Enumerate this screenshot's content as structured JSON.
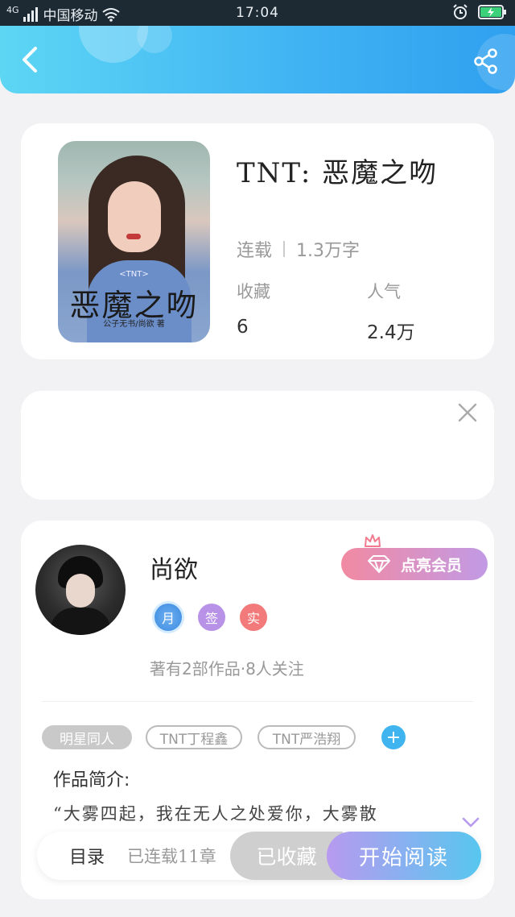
{
  "status_bar": {
    "network": "4G",
    "carrier": "中国移动",
    "time": "17:04"
  },
  "colors": {
    "header_gradient_start": "#5dd6f4",
    "header_gradient_end": "#2fa0ef",
    "accent_blue": "#3fb4ee",
    "vip_start": "#f28aa2",
    "vip_end": "#c19ae5",
    "read_start": "#b89af0",
    "read_end": "#57c7ef"
  },
  "header": {
    "back_icon": "chevron-left-icon",
    "share_icon": "share-icon"
  },
  "book": {
    "cover": {
      "tag": "<TNT>",
      "title": "恶魔之吻",
      "author_line": "公子无书/尚欲 著"
    },
    "title": "TNT: 恶魔之吻",
    "status": "连载",
    "word_count": "1.3万字",
    "stats": [
      {
        "label": "收藏",
        "value": "6"
      },
      {
        "label": "人气",
        "value": "2.4万"
      }
    ]
  },
  "author": {
    "name": "尚欲",
    "vip_button": "点亮会员",
    "badges": [
      {
        "text": "月",
        "color": "#4a9be8"
      },
      {
        "text": "签",
        "color": "#b892e6"
      },
      {
        "text": "实",
        "color": "#f27a7a"
      }
    ],
    "meta": "著有2部作品·8人关注"
  },
  "tags": [
    {
      "label": "明星同人",
      "style": "filled"
    },
    {
      "label": "TNT丁程鑫",
      "style": "outline"
    },
    {
      "label": "TNT严浩翔",
      "style": "outline"
    }
  ],
  "intro": {
    "title": "作品简介:",
    "text": "“大雾四起，我在无人之处爱你，大雾散"
  },
  "bottom_bar": {
    "toc_label": "目录",
    "progress": "已连载11章",
    "collect_label": "已收藏",
    "read_label": "开始阅读"
  }
}
